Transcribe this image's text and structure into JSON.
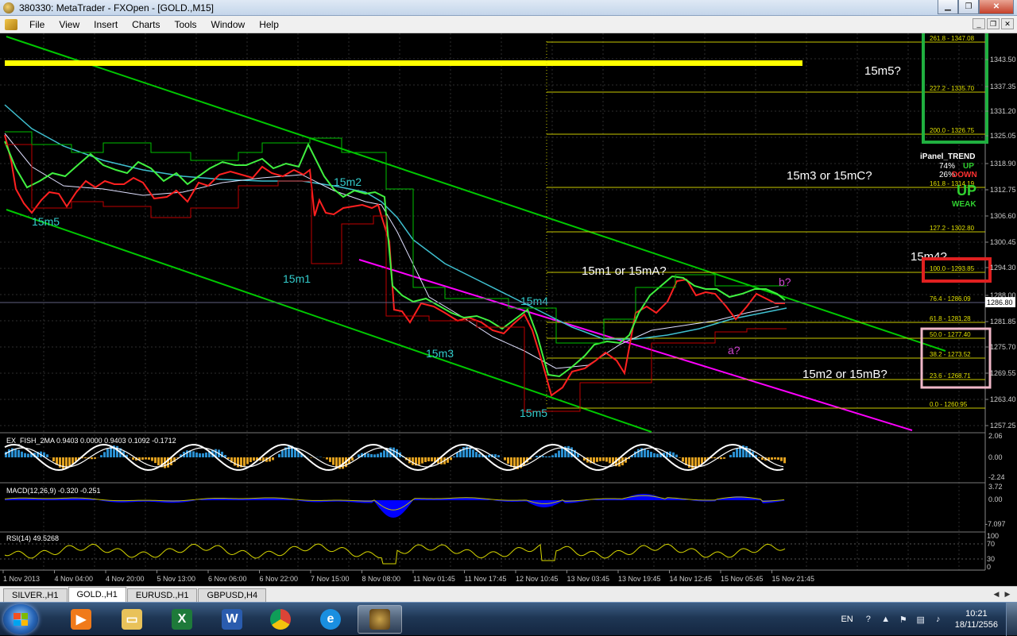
{
  "window": {
    "title": "380330: MetaTrader - FXOpen - [GOLD.,M15]"
  },
  "menu": [
    "File",
    "View",
    "Insert",
    "Charts",
    "Tools",
    "Window",
    "Help"
  ],
  "price_scale": {
    "main": [
      "1343.50",
      "1337.35",
      "1331.20",
      "1325.05",
      "1318.90",
      "1312.75",
      "1306.60",
      "1300.45",
      "1294.30",
      "1288.00",
      "1281.85",
      "1275.70",
      "1269.55",
      "1263.40",
      "1257.25"
    ],
    "current": "1286.80",
    "fish": [
      "2.06",
      "0.00",
      "-2.24"
    ],
    "macd": [
      "3.72",
      "0.00",
      "-7.097"
    ],
    "rsi": [
      "100",
      "70",
      "30",
      "0"
    ]
  },
  "fib_levels": [
    "261.8 - 1347.08",
    "227.2 - 1335.70",
    "200.0 - 1326.75",
    "161.8 - 1314.19",
    "127.2 - 1302.80",
    "100.0 - 1293.85",
    "76.4 - 1286.09",
    "61.8 - 1281.28",
    "50.0 - 1277.40",
    "38.2 - 1273.52",
    "23.6 - 1268.71",
    "0.0 - 1260.95"
  ],
  "annotations": {
    "m5_left": "15m5",
    "m1": "15m1",
    "m2": "15m2",
    "m3": "15m3",
    "m4": "15m4",
    "m5_bottom": "15m5",
    "m1_or_A": "15m1 or 15mA?",
    "m3_or_C": "15m3 or 15mC?",
    "m2_or_B": "15m2 or 15mB?",
    "m4_q": "15m4?",
    "m5_q": "15m5?",
    "a_q": "a?",
    "b_q": "b?"
  },
  "ipanel": {
    "title": "iPanel_TREND",
    "up_pct": "74%",
    "up": "UP",
    "down_pct": "26%",
    "down": "DOWN",
    "big": "UP",
    "strength": "WEAK"
  },
  "indicators": {
    "fish": "EX_FISH_2MA 0.9403 0.0000 0.9403 0.1092 -0.1712",
    "macd": "MACD(12,26,9) -0.320 -0.251",
    "rsi": "RSI(14) 49.5268"
  },
  "time_axis": [
    "1 Nov 2013",
    "4 Nov 04:00",
    "4 Nov 20:00",
    "5 Nov 13:00",
    "6 Nov 06:00",
    "6 Nov 22:00",
    "7 Nov 15:00",
    "8 Nov 08:00",
    "11 Nov 01:45",
    "11 Nov 17:45",
    "12 Nov 10:45",
    "13 Nov 03:45",
    "13 Nov 19:45",
    "14 Nov 12:45",
    "15 Nov 05:45",
    "15 Nov 21:45"
  ],
  "tabs": [
    "SILVER.,H1",
    "GOLD.,H1",
    "EURUSD.,H1",
    "GBPUSD,H4"
  ],
  "active_tab": "GOLD.,H1",
  "taskbar": {
    "lang": "EN",
    "time": "10:21",
    "date": "18/11/2556"
  },
  "colors": {
    "fib": "#d8d800",
    "channel": "#00d000",
    "magenta": "#ff00ff",
    "cyan_label": "#33cccc",
    "grid": "#3a3a3a"
  }
}
